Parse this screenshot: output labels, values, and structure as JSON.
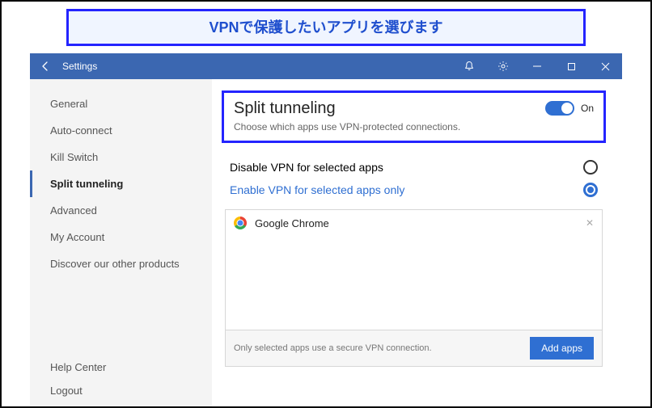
{
  "callout": {
    "text": "VPNで保護したいアプリを選びます"
  },
  "titlebar": {
    "title": "Settings"
  },
  "sidebar": {
    "items": [
      {
        "label": "General",
        "active": false
      },
      {
        "label": "Auto-connect",
        "active": false
      },
      {
        "label": "Kill Switch",
        "active": false
      },
      {
        "label": "Split tunneling",
        "active": true
      },
      {
        "label": "Advanced",
        "active": false
      },
      {
        "label": "My Account",
        "active": false
      },
      {
        "label": "Discover our other products",
        "active": false
      }
    ],
    "bottom": [
      {
        "label": "Help Center"
      },
      {
        "label": "Logout"
      }
    ]
  },
  "main": {
    "heading": "Split tunneling",
    "subheading": "Choose which apps use VPN-protected connections.",
    "toggle": {
      "on": true,
      "label": "On"
    },
    "options": [
      {
        "label": "Disable VPN for selected apps",
        "selected": false
      },
      {
        "label": "Enable VPN for selected apps only",
        "selected": true
      }
    ],
    "apps": [
      {
        "name": "Google Chrome",
        "icon": "chrome-icon"
      }
    ],
    "footer_note": "Only selected apps use a secure VPN connection.",
    "add_button": "Add apps"
  }
}
